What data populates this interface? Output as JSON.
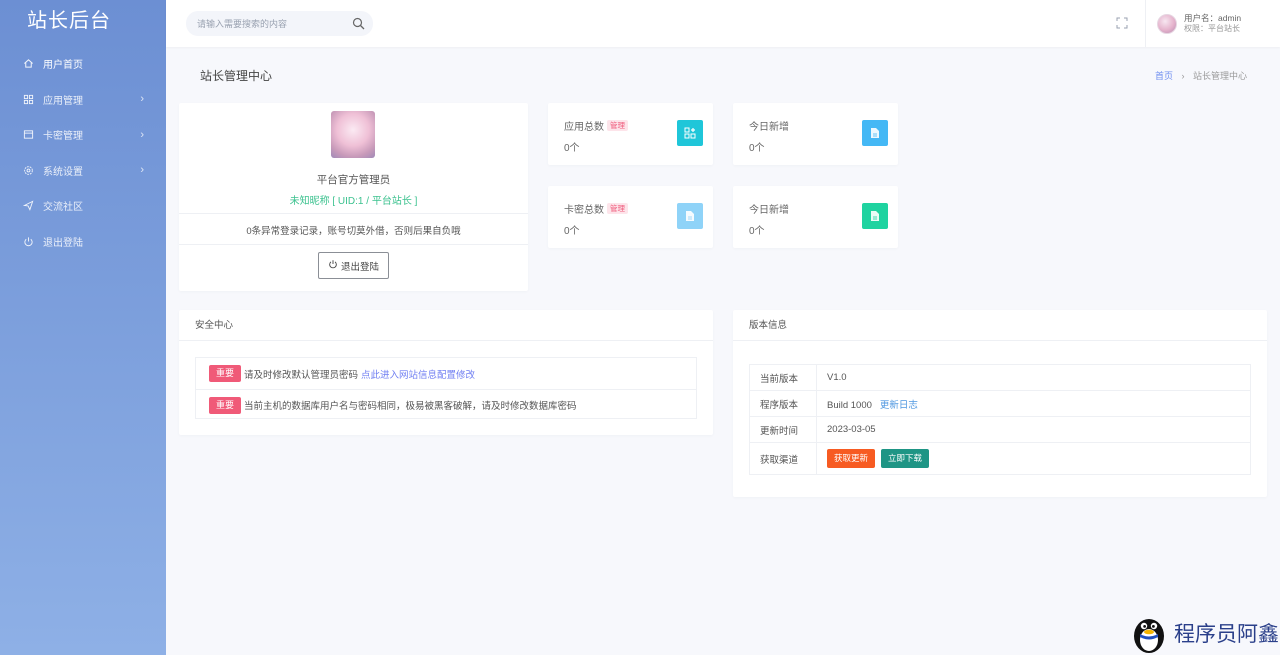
{
  "app": {
    "brand": "站长后台"
  },
  "sidebar": {
    "items": [
      {
        "label": "用户首页",
        "icon": "home-icon"
      },
      {
        "label": "应用管理",
        "icon": "apps-icon"
      },
      {
        "label": "卡密管理",
        "icon": "card-icon"
      },
      {
        "label": "系统设置",
        "icon": "gear-icon"
      },
      {
        "label": "交流社区",
        "icon": "send-icon"
      },
      {
        "label": "退出登陆",
        "icon": "power-icon"
      }
    ]
  },
  "header": {
    "search_placeholder": "请输入需要搜索的内容",
    "user_line": "用户名：admin",
    "role_line": "权限：平台站长"
  },
  "page": {
    "title": "站长管理中心",
    "breadcrumb_home": "首页",
    "breadcrumb_sep": "›",
    "breadcrumb_current": "站长管理中心"
  },
  "profile": {
    "name": "平台官方管理员",
    "uid_line": "未知昵称 [ UID:1 / 平台站长 ]",
    "notice": "0条异常登录记录，账号切莫外借，否则后果自负哦",
    "logout_label": "退出登陆"
  },
  "stats": [
    {
      "label": "应用总数",
      "tag": "管理",
      "value": "0个",
      "icon_color": "#1fc6d9",
      "icon": "apps-add-icon"
    },
    {
      "label": "今日新增",
      "tag": "",
      "value": "0个",
      "icon_color": "#44b8f5",
      "icon": "document-icon"
    },
    {
      "label": "卡密总数",
      "tag": "管理",
      "value": "0个",
      "icon_color": "#8fd3f8",
      "icon": "document-icon"
    },
    {
      "label": "今日新增",
      "tag": "",
      "value": "0个",
      "icon_color": "#1fd3a0",
      "icon": "document-icon"
    }
  ],
  "security": {
    "title": "安全中心",
    "rows": [
      {
        "badge": "重要",
        "text": "请及时修改默认管理员密码",
        "link": "点此进入网站信息配置修改"
      },
      {
        "badge": "重要",
        "text": "当前主机的数据库用户名与密码相同，极易被黑客破解，请及时修改数据库密码",
        "link": ""
      }
    ]
  },
  "version": {
    "title": "版本信息",
    "rows": [
      {
        "key": "当前版本",
        "value": "V1.0"
      },
      {
        "key": "程序版本",
        "value": "Build 1000",
        "link": "更新日志"
      },
      {
        "key": "更新时间",
        "value": "2023-03-05"
      },
      {
        "key": "获取渠道",
        "btn1": "获取更新",
        "btn2": "立即下载"
      }
    ]
  },
  "watermark": {
    "text": "程序员阿鑫"
  }
}
